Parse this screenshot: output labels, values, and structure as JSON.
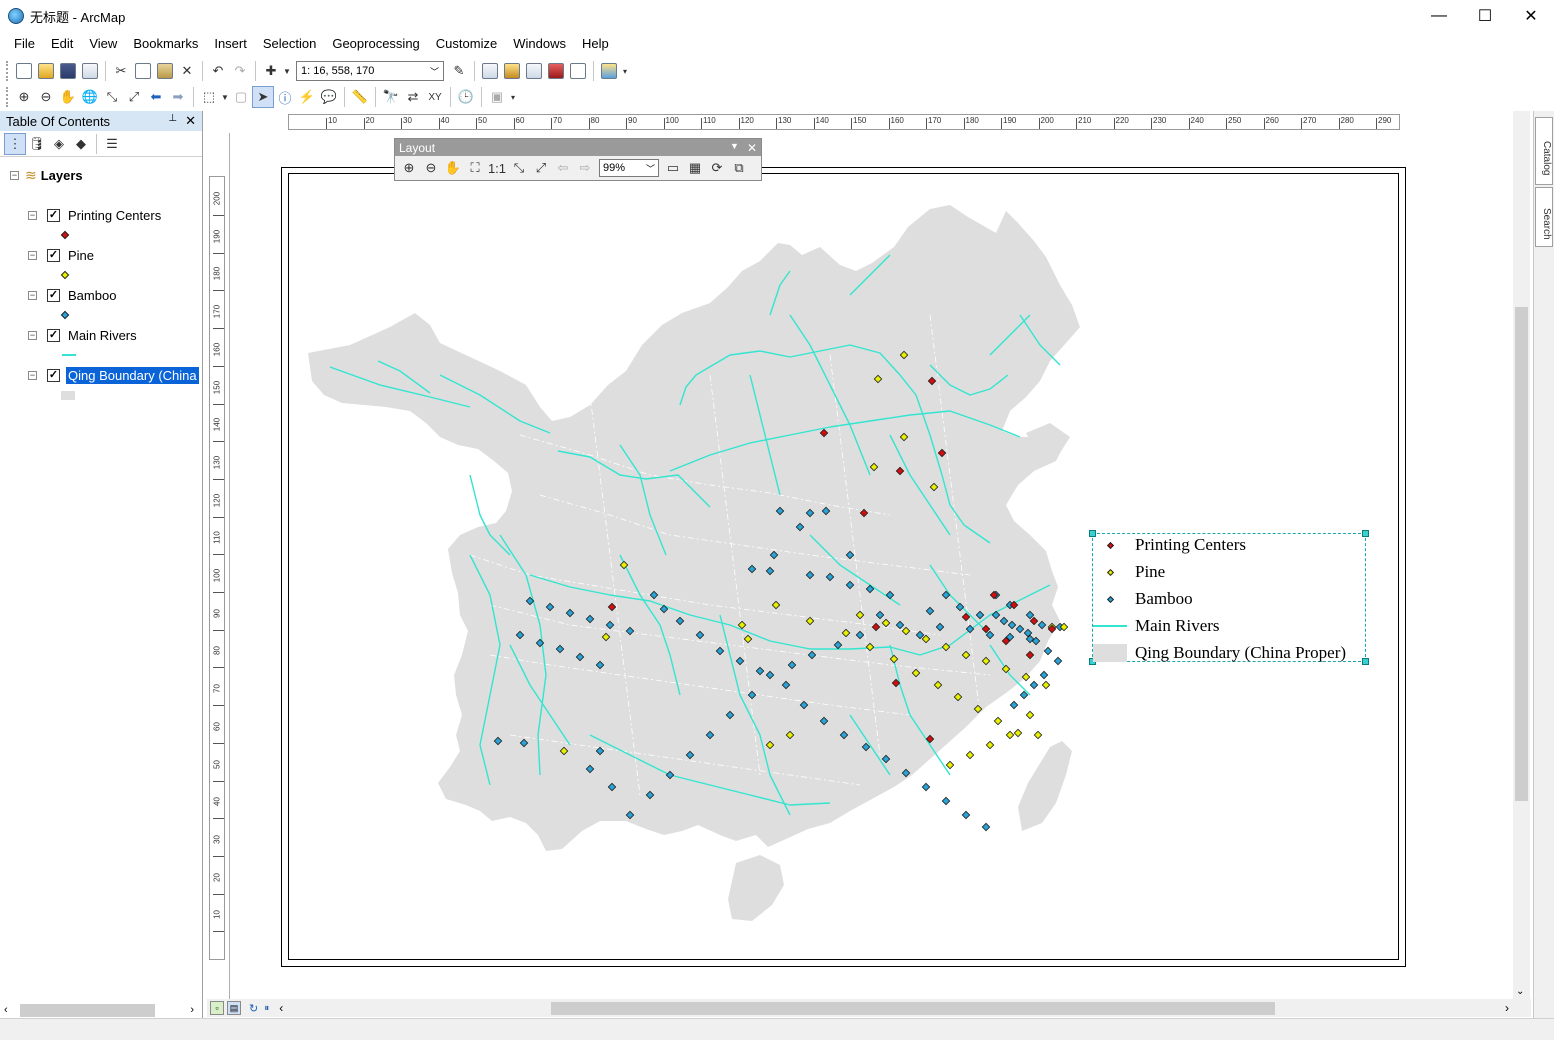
{
  "window": {
    "title": "无标题 - ArcMap",
    "minimize": "—",
    "maximize": "☐",
    "close": "✕"
  },
  "menu": [
    "File",
    "Edit",
    "View",
    "Bookmarks",
    "Insert",
    "Selection",
    "Geoprocessing",
    "Customize",
    "Windows",
    "Help"
  ],
  "toolbar": {
    "scale": "1: 16, 558, 170"
  },
  "toc": {
    "title": "Table Of Contents",
    "pin": "📌",
    "close": "✕",
    "root": "Layers",
    "layers": [
      {
        "name": "Printing Centers",
        "checked": true,
        "symbol": "point",
        "color": "#d01010"
      },
      {
        "name": "Pine",
        "checked": true,
        "symbol": "point",
        "color": "#e8f000"
      },
      {
        "name": "Bamboo",
        "checked": true,
        "symbol": "point",
        "color": "#2aa3d6"
      },
      {
        "name": "Main Rivers",
        "checked": true,
        "symbol": "line",
        "color": "#33e5cf"
      },
      {
        "name": "Qing Boundary (China",
        "checked": true,
        "symbol": "polygon",
        "color": "#dedede",
        "selected": true
      }
    ]
  },
  "layout_toolbar": {
    "title": "Layout",
    "zoom": "99%"
  },
  "ruler": {
    "h_labels": [
      "10",
      "20",
      "30",
      "40",
      "50",
      "60",
      "70",
      "80",
      "90",
      "100",
      "110",
      "120",
      "130",
      "140",
      "150",
      "160",
      "170",
      "180",
      "190",
      "200",
      "210",
      "220",
      "230",
      "240",
      "250",
      "260",
      "270",
      "280",
      "290"
    ],
    "v_labels": [
      "200",
      "190",
      "180",
      "170",
      "160",
      "150",
      "140",
      "130",
      "120",
      "110",
      "100",
      "90",
      "80",
      "70",
      "60",
      "50",
      "40",
      "30",
      "20",
      "10"
    ]
  },
  "legend": [
    {
      "label": "Printing Centers",
      "symbol": "point",
      "color": "#d01010"
    },
    {
      "label": "Pine",
      "symbol": "point",
      "color": "#e8f000"
    },
    {
      "label": "Bamboo",
      "symbol": "point",
      "color": "#2aa3d6"
    },
    {
      "label": "Main Rivers",
      "symbol": "line",
      "color": "#33e5cf"
    },
    {
      "label": "Qing Boundary (China Proper)",
      "symbol": "polygon",
      "color": "#dedede"
    }
  ],
  "side_tabs": [
    "Catalog",
    "Search"
  ],
  "colors": {
    "land": "#dedede",
    "river": "#33e5cf",
    "boundary": "#ffffff",
    "printing": "#d01010",
    "pine": "#e8f000",
    "bamboo": "#2aa3d6",
    "selection": "#1aa9a9"
  }
}
